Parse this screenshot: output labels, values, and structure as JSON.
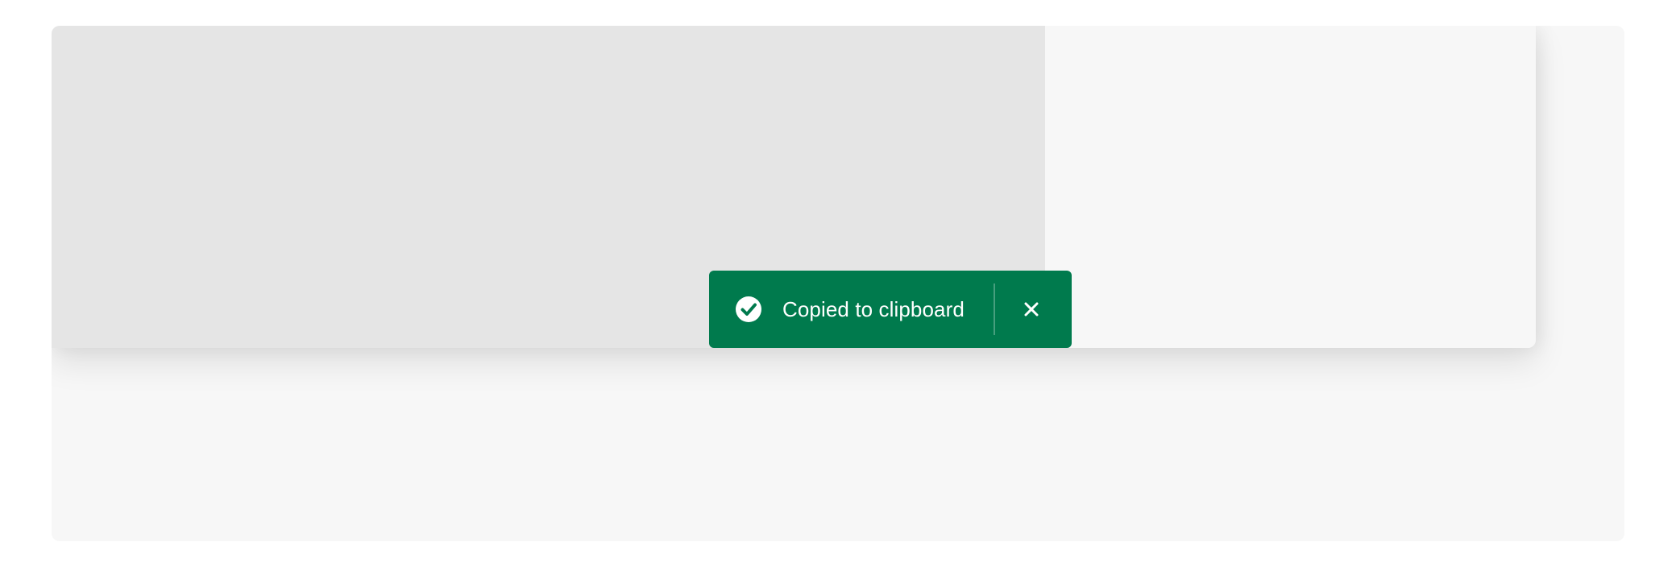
{
  "toast": {
    "message": "Copied to clipboard",
    "status": "positive",
    "status_icon": "checkmark-circle-icon",
    "close_icon": "close-icon",
    "background_color": "#007a4d"
  },
  "colors": {
    "preview_background": "#e5e5e5",
    "side_background": "#f7f7f7",
    "page_background": "#ffffff"
  }
}
